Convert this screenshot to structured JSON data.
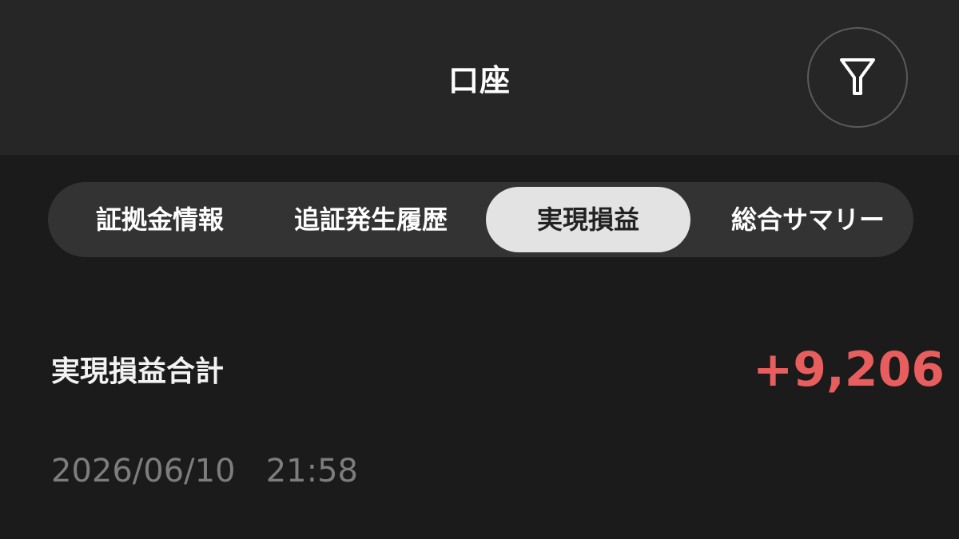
{
  "header": {
    "title": "口座",
    "filter_icon": "filter-icon"
  },
  "tabs": [
    {
      "label": "証拠金情報",
      "active": false
    },
    {
      "label": "追証発生履歴",
      "active": false
    },
    {
      "label": "実現損益",
      "active": true
    },
    {
      "label": "総合サマリー",
      "active": false
    }
  ],
  "summary": {
    "label": "実現損益合計",
    "value": "+9,206",
    "value_color": "#e85d5d",
    "date": "2026/06/10",
    "time": "21:58"
  },
  "colors": {
    "background": "#1b1b1b",
    "header_bg": "#262626",
    "tab_bar_bg": "#333333",
    "active_tab_bg": "#e3e3e3"
  }
}
